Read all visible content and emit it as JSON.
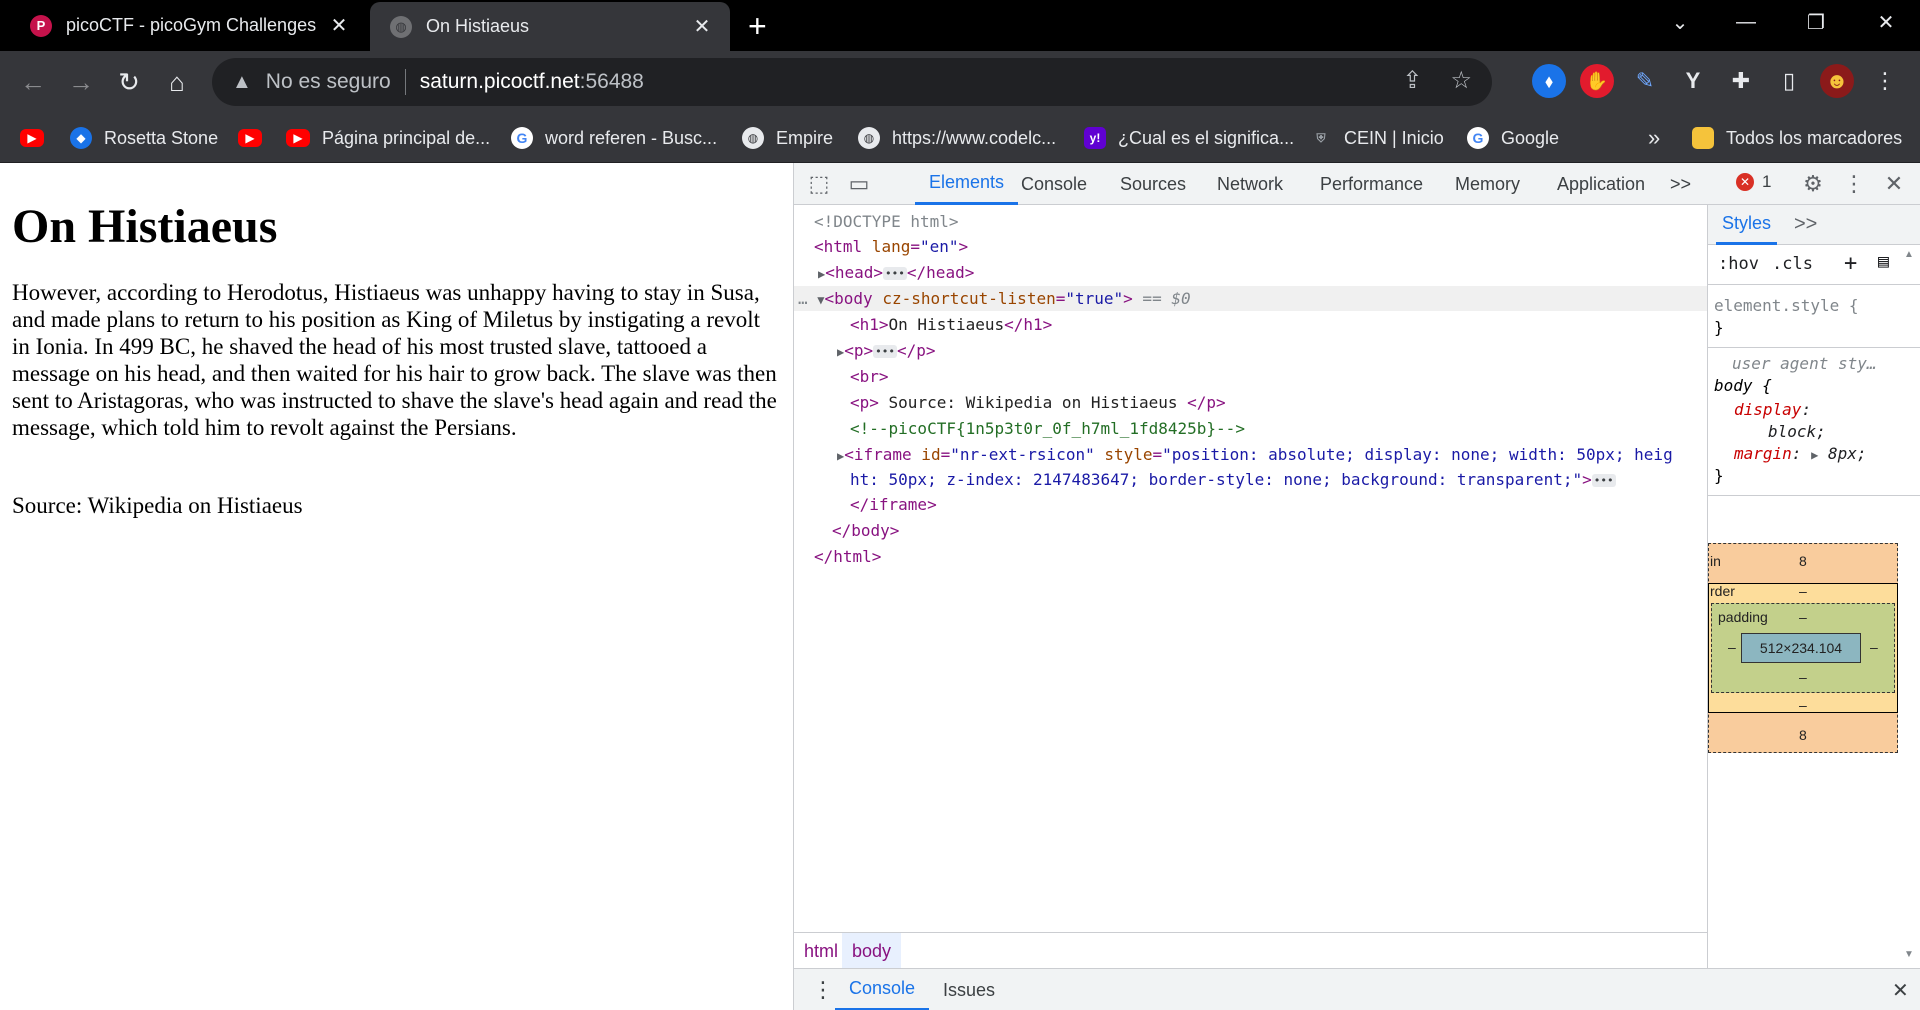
{
  "tabs": [
    {
      "title": "picoCTF - picoGym Challenges",
      "favicon": "P",
      "active": false
    },
    {
      "title": "On Histiaeus",
      "favicon": "",
      "active": true
    }
  ],
  "toolbar": {
    "security_label": "No es seguro",
    "host": "saturn.picoctf.net",
    "port": ":56488"
  },
  "bookmarks": [
    {
      "label": ""
    },
    {
      "label": "Rosetta Stone"
    },
    {
      "label": ""
    },
    {
      "label": "Página principal de..."
    },
    {
      "label": "word referen - Busc..."
    },
    {
      "label": "Empire"
    },
    {
      "label": "https://www.codelc..."
    },
    {
      "label": "¿Cual es el significa..."
    },
    {
      "label": "CEIN | Inicio"
    },
    {
      "label": "Google"
    }
  ],
  "bookmarks_more": "»",
  "bookmarks_all": "Todos los marcadores",
  "page": {
    "heading": "On Histiaeus",
    "paragraph": "However, according to Herodotus, Histiaeus was unhappy having to stay in Susa, and made plans to return to his position as King of Miletus by instigating a revolt in Ionia. In 499 BC, he shaved the head of his most trusted slave, tattooed a message on his head, and then waited for his hair to grow back. The slave was then sent to Aristagoras, who was instructed to shave the slave's head again and read the message, which told him to revolt against the Persians.",
    "source": "Source: Wikipedia on Histiaeus"
  },
  "devtools": {
    "tabs": [
      "Elements",
      "Console",
      "Sources",
      "Network",
      "Performance",
      "Memory",
      "Application"
    ],
    "more": ">>",
    "error_count": "1",
    "dom": {
      "doctype": "<!DOCTYPE html>",
      "html_open_tag": "<html",
      "html_attr_name": " lang",
      "html_attr_value": "\"en\"",
      "head_open": "<head>",
      "head_close": "</head>",
      "body_open": "<body",
      "body_attr_name": " cz-shortcut-listen",
      "body_attr_value": "\"true\"",
      "body_selected_marker": " == $0",
      "h1_line": "<h1>",
      "h1_text": "On Histiaeus",
      "h1_close": "</h1>",
      "p_open": "<p>",
      "p_close": "</p>",
      "br": "<br>",
      "p2_text": " Source: Wikipedia on Histiaeus ",
      "comment": "<!--picoCTF{1n5p3t0r_0f_h7ml_1fd8425b}-->",
      "iframe_open": "<iframe",
      "iframe_id_name": " id",
      "iframe_id_value": "\"nr-ext-rsicon\"",
      "iframe_style_name": " style",
      "iframe_style_value_1": "\"position: absolute; display: none; width: 50px; heig",
      "iframe_style_value_2": "ht: 50px; z-index: 2147483647; border-style: none; background: transparent;\"",
      "iframe_close": "</iframe>",
      "body_close": "</body>",
      "html_close": "</html>"
    },
    "breadcrumbs": [
      "html",
      "body"
    ],
    "styles": {
      "tab": "Styles",
      "more": ">>",
      "filter_hov": ":hov",
      "filter_cls": ".cls",
      "element_style_selector": "element.style {",
      "close_brace": "}",
      "ua_label": "user agent sty…",
      "body_selector": "body {",
      "display_prop": "display",
      "display_value": "block;",
      "margin_prop": "margin",
      "margin_value": "8px;"
    },
    "box_model": {
      "margin_label": "in",
      "margin_top": "8",
      "border_label": "rder",
      "border_top": "–",
      "padding_label": "padding",
      "padding_top": "–",
      "padding_left": "–",
      "padding_right": "–",
      "padding_bottom": "–",
      "content_size": "512×234.104",
      "border_bottom": "–",
      "margin_bottom": "8"
    },
    "drawer_tabs": [
      "Console",
      "Issues"
    ]
  }
}
